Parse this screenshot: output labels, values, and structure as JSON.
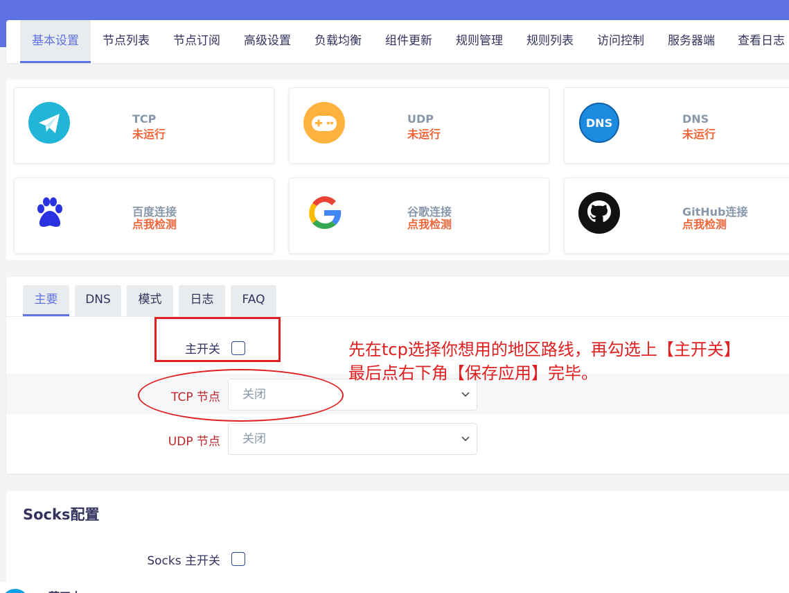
{
  "tabs": [
    "基本设置",
    "节点列表",
    "节点订阅",
    "高级设置",
    "负载均衡",
    "组件更新",
    "规则管理",
    "规则列表",
    "访问控制",
    "服务器端",
    "查看日志"
  ],
  "status_cards": [
    {
      "title": "TCP",
      "value": "未运行",
      "icon": "telegram-plane-icon",
      "color": "#21b6d8"
    },
    {
      "title": "UDP",
      "value": "未运行",
      "icon": "gamepad-icon",
      "color": "#ffb23e"
    },
    {
      "title": "DNS",
      "value": "未运行",
      "icon": "dns-icon",
      "color": "#1b8be0"
    },
    {
      "title": "百度连接",
      "value": "点我检测",
      "icon": "baidu-paw-icon",
      "color": "#2932e1"
    },
    {
      "title": "谷歌连接",
      "value": "点我检测",
      "icon": "google-g-icon",
      "color": "#4285f4"
    },
    {
      "title": "GitHub连接",
      "value": "点我检测",
      "icon": "github-icon",
      "color": "#111111"
    }
  ],
  "main": {
    "subtabs": [
      "主要",
      "DNS",
      "模式",
      "日志",
      "FAQ"
    ],
    "main_switch_label": "主开关",
    "tcp_label": "TCP 节点",
    "tcp_value": "关闭",
    "udp_label": "UDP 节点",
    "udp_value": "关闭",
    "label_red": "#c0262c",
    "accent": "#5e72e4"
  },
  "annotation": {
    "line1": "先在tcp选择你想用的地区路线，再勾选上【主开关】",
    "line2": "最后点右下角【保存应用】完毕。",
    "color": "#e02020"
  },
  "socks": {
    "title": "Socks配置",
    "switch_label": "Socks 主开关"
  },
  "footer": {
    "name": "蓝四中"
  }
}
